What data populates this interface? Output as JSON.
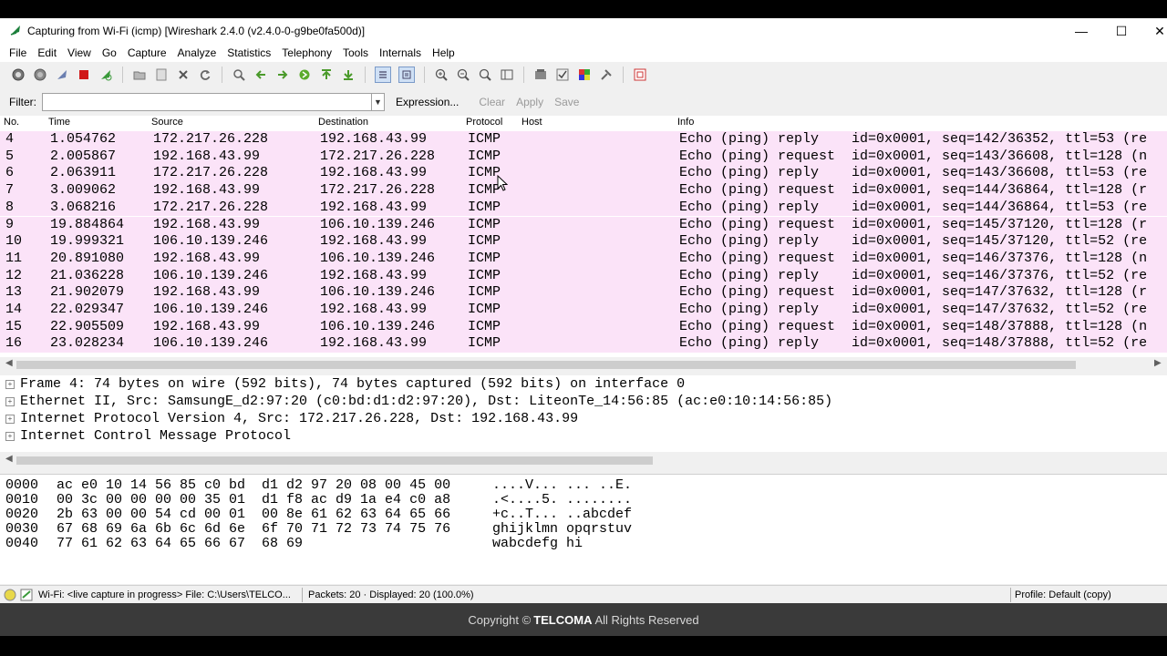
{
  "window": {
    "title": "Capturing from Wi-Fi (icmp) [Wireshark 2.4.0 (v2.4.0-0-g9be0fa500d)]",
    "minimize": "—",
    "maximize": "☐",
    "close": "✕"
  },
  "menu": [
    "File",
    "Edit",
    "View",
    "Go",
    "Capture",
    "Analyze",
    "Statistics",
    "Telephony",
    "Tools",
    "Internals",
    "Help"
  ],
  "toolbar_icons": [
    "start-capture-icon",
    "stop-capture-icon",
    "restart-capture-icon",
    "capture-options-icon",
    "reload-icon",
    "open-file-icon",
    "save-file-icon",
    "close-file-icon",
    "reload-file-icon",
    "find-packet-icon",
    "go-back-icon",
    "go-forward-icon",
    "go-to-packet-icon",
    "go-first-icon",
    "go-last-icon",
    "colorize-icon",
    "autoscroll-icon",
    "zoom-in-icon",
    "zoom-out-icon",
    "normal-size-icon",
    "resize-columns-icon",
    "capture-filters-icon",
    "display-filters-icon",
    "coloring-rules-icon",
    "preferences-icon",
    "help-icon"
  ],
  "filter": {
    "label": "Filter:",
    "value": "",
    "expression": "Expression...",
    "clear": "Clear",
    "apply": "Apply",
    "save": "Save"
  },
  "columns": [
    "No.",
    "Time",
    "Source",
    "Destination",
    "Protocol",
    "Host",
    "Info"
  ],
  "packets": [
    {
      "no": "4",
      "time": "1.054762",
      "src": "172.217.26.228",
      "dst": "192.168.43.99",
      "proto": "ICMP",
      "info": "Echo (ping) reply    id=0x0001, seq=142/36352, ttl=53 (re"
    },
    {
      "no": "5",
      "time": "2.005867",
      "src": "192.168.43.99",
      "dst": "172.217.26.228",
      "proto": "ICMP",
      "info": "Echo (ping) request  id=0x0001, seq=143/36608, ttl=128 (n"
    },
    {
      "no": "6",
      "time": "2.063911",
      "src": "172.217.26.228",
      "dst": "192.168.43.99",
      "proto": "ICMP",
      "info": "Echo (ping) reply    id=0x0001, seq=143/36608, ttl=53 (re"
    },
    {
      "no": "7",
      "time": "3.009062",
      "src": "192.168.43.99",
      "dst": "172.217.26.228",
      "proto": "ICMP",
      "info": "Echo (ping) request  id=0x0001, seq=144/36864, ttl=128 (r"
    },
    {
      "no": "8",
      "time": "3.068216",
      "src": "172.217.26.228",
      "dst": "192.168.43.99",
      "proto": "ICMP",
      "info": "Echo (ping) reply    id=0x0001, seq=144/36864, ttl=53 (re"
    },
    {
      "no": "9",
      "time": "19.884864",
      "src": "192.168.43.99",
      "dst": "106.10.139.246",
      "proto": "ICMP",
      "info": "Echo (ping) request  id=0x0001, seq=145/37120, ttl=128 (r"
    },
    {
      "no": "10",
      "time": "19.999321",
      "src": "106.10.139.246",
      "dst": "192.168.43.99",
      "proto": "ICMP",
      "info": "Echo (ping) reply    id=0x0001, seq=145/37120, ttl=52 (re"
    },
    {
      "no": "11",
      "time": "20.891080",
      "src": "192.168.43.99",
      "dst": "106.10.139.246",
      "proto": "ICMP",
      "info": "Echo (ping) request  id=0x0001, seq=146/37376, ttl=128 (n"
    },
    {
      "no": "12",
      "time": "21.036228",
      "src": "106.10.139.246",
      "dst": "192.168.43.99",
      "proto": "ICMP",
      "info": "Echo (ping) reply    id=0x0001, seq=146/37376, ttl=52 (re"
    },
    {
      "no": "13",
      "time": "21.902079",
      "src": "192.168.43.99",
      "dst": "106.10.139.246",
      "proto": "ICMP",
      "info": "Echo (ping) request  id=0x0001, seq=147/37632, ttl=128 (r"
    },
    {
      "no": "14",
      "time": "22.029347",
      "src": "106.10.139.246",
      "dst": "192.168.43.99",
      "proto": "ICMP",
      "info": "Echo (ping) reply    id=0x0001, seq=147/37632, ttl=52 (re"
    },
    {
      "no": "15",
      "time": "22.905509",
      "src": "192.168.43.99",
      "dst": "106.10.139.246",
      "proto": "ICMP",
      "info": "Echo (ping) request  id=0x0001, seq=148/37888, ttl=128 (n"
    },
    {
      "no": "16",
      "time": "23.028234",
      "src": "106.10.139.246",
      "dst": "192.168.43.99",
      "proto": "ICMP",
      "info": "Echo (ping) reply    id=0x0001, seq=148/37888, ttl=52 (re"
    }
  ],
  "details": [
    "Frame 4: 74 bytes on wire (592 bits), 74 bytes captured (592 bits) on interface 0",
    "Ethernet II, Src: SamsungE_d2:97:20 (c0:bd:d1:d2:97:20), Dst: LiteonTe_14:56:85 (ac:e0:10:14:56:85)",
    "Internet Protocol Version 4, Src: 172.217.26.228, Dst: 192.168.43.99",
    "Internet Control Message Protocol"
  ],
  "bytes": [
    {
      "off": "0000",
      "hex": "ac e0 10 14 56 85 c0 bd  d1 d2 97 20 08 00 45 00",
      "ascii": "....V... ... ..E."
    },
    {
      "off": "0010",
      "hex": "00 3c 00 00 00 00 35 01  d1 f8 ac d9 1a e4 c0 a8",
      "ascii": ".<....5. ........"
    },
    {
      "off": "0020",
      "hex": "2b 63 00 00 54 cd 00 01  00 8e 61 62 63 64 65 66",
      "ascii": "+c..T... ..abcdef"
    },
    {
      "off": "0030",
      "hex": "67 68 69 6a 6b 6c 6d 6e  6f 70 71 72 73 74 75 76",
      "ascii": "ghijklmn opqrstuv"
    },
    {
      "off": "0040",
      "hex": "77 61 62 63 64 65 66 67  68 69",
      "ascii": "wabcdefg hi"
    }
  ],
  "status": {
    "capture": "Wi-Fi: <live capture in progress> File: C:\\Users\\TELCO...",
    "packets": "Packets: 20 · Displayed: 20 (100.0%)",
    "profile": "Profile: Default (copy)"
  },
  "footer": {
    "prefix": "Copyright ©",
    "brand": "TELCOMA",
    "suffix": "All Rights Reserved"
  },
  "colors": {
    "icmp_row": "#fbe3f8",
    "footer_bg": "#3a3a3a"
  }
}
